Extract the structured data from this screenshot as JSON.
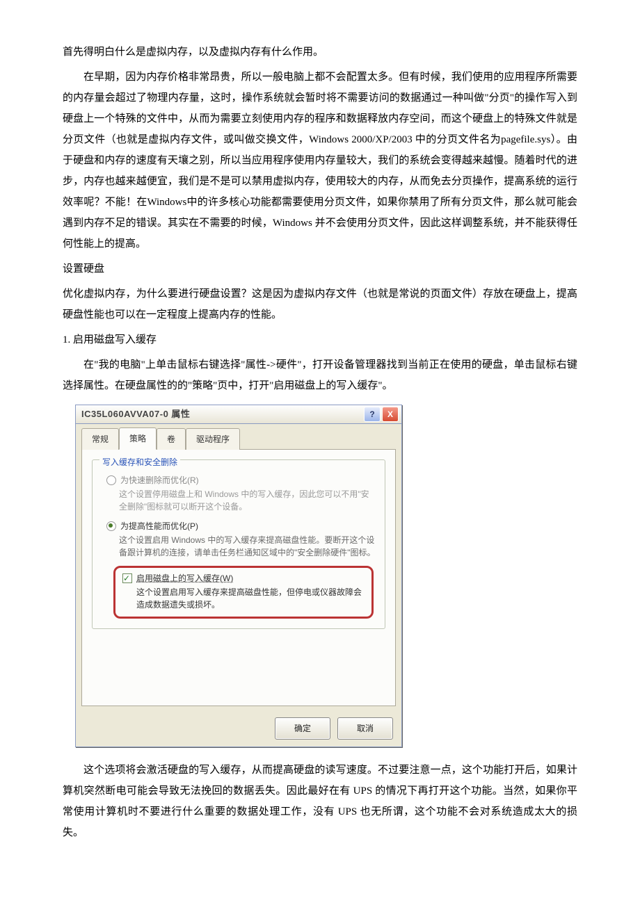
{
  "intro": {
    "p1": "首先得明白什么是虚拟内存，以及虚拟内存有什么作用。",
    "p2": "在早期，因为内存价格非常昂贵，所以一般电脑上都不会配置太多。但有时候，我们使用的应用程序所需要的内存量会超过了物理内存量，这时，操作系统就会暂时将不需要访问的数据通过一种叫做\"分页\"的操作写入到硬盘上一个特殊的文件中，从而为需要立刻使用内存的程序和数据释放内存空间，而这个硬盘上的特殊文件就是分页文件（也就是虚拟内存文件，或叫做交换文件，Windows 2000/XP/2003 中的分页文件名为pagefile.sys）。由于硬盘和内存的速度有天壤之别，所以当应用程序使用内存量较大，我们的系统会变得越来越慢。随着时代的进步，内存也越来越便宜，我们是不是可以禁用虚拟内存，使用较大的内存，从而免去分页操作，提高系统的运行效率呢？不能！在Windows中的许多核心功能都需要使用分页文件，如果你禁用了所有分页文件，那么就可能会遇到内存不足的错误。其实在不需要的时候，Windows 并不会使用分页文件，因此这样调整系统，并不能获得任何性能上的提高。"
  },
  "section1": {
    "head": "设置硬盘",
    "p1": "优化虚拟内存，为什么要进行硬盘设置？这是因为虚拟内存文件（也就是常说的页面文件）存放在硬盘上，提高硬盘性能也可以在一定程度上提高内存的性能。",
    "sub1": "1. 启用磁盘写入缓存",
    "p2": "在\"我的电脑\"上单击鼠标右键选择\"属性->硬件\"，打开设备管理器找到当前正在使用的硬盘，单击鼠标右键选择属性。在硬盘属性的的\"策略\"页中，打开\"启用磁盘上的写入缓存\"。"
  },
  "dialog": {
    "title": "IC35L060AVVA07-0 属性",
    "help": "?",
    "close": "X",
    "tabs": [
      "常规",
      "策略",
      "卷",
      "驱动程序"
    ],
    "active_tab_index": 1,
    "group_title": "写入缓存和安全删除",
    "opt1": {
      "label": "为快速删除而优化(R)",
      "desc": "这个设置停用磁盘上和 Windows 中的写入缓存，因此您可以不用\"安全删除\"图标就可以断开这个设备。"
    },
    "opt2": {
      "label": "为提高性能而优化(P)",
      "desc": "这个设置启用 Windows 中的写入缓存来提高磁盘性能。要断开这个设备跟计算机的连接，请单击任务栏通知区域中的\"安全删除硬件\"图标。"
    },
    "check": {
      "label": "启用磁盘上的写入缓存(W)",
      "desc": "这个设置启用写入缓存来提高磁盘性能，但停电或仪器故障会造成数据遗失或损坏。"
    },
    "buttons": {
      "ok": "确定",
      "cancel": "取消"
    }
  },
  "after": {
    "p1": "这个选项将会激活硬盘的写入缓存，从而提高硬盘的读写速度。不过要注意一点，这个功能打开后，如果计算机突然断电可能会导致无法挽回的数据丢失。因此最好在有 UPS 的情况下再打开这个功能。当然，如果你平常使用计算机时不要进行什么重要的数据处理工作，没有 UPS 也无所谓，这个功能不会对系统造成太大的损失。"
  }
}
